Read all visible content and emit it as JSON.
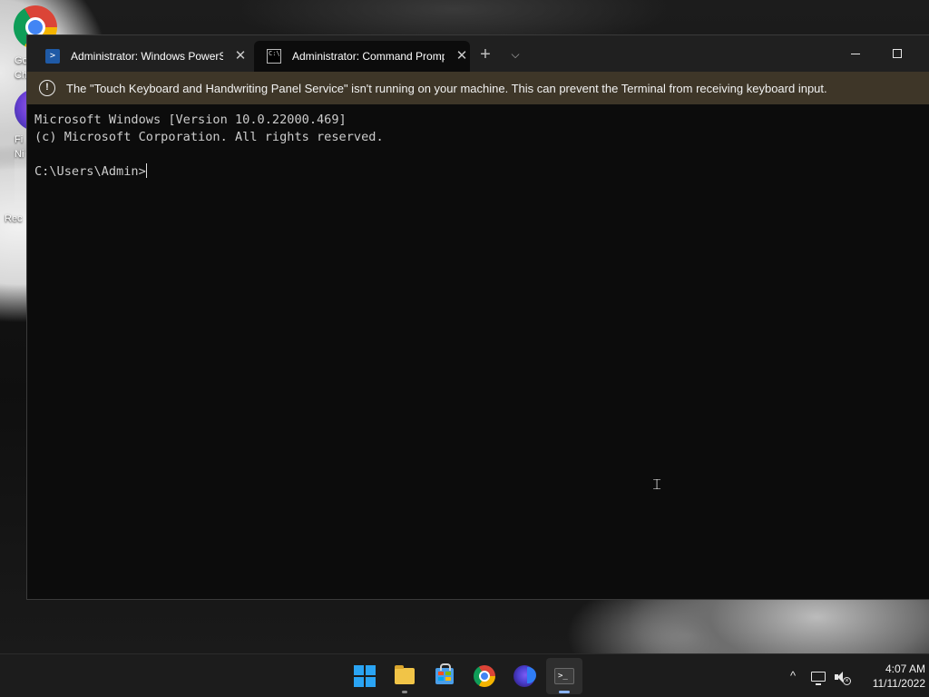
{
  "desktop": {
    "icons": [
      {
        "name": "google-chrome",
        "label_lines": [
          "Go",
          "Ch"
        ]
      },
      {
        "name": "firefox-nightly",
        "label_lines": [
          "Fi",
          "Ni"
        ]
      },
      {
        "name": "recycle-bin",
        "label_lines": [
          "Rec"
        ]
      }
    ]
  },
  "window": {
    "tabs": [
      {
        "title": "Administrator: Windows PowerS",
        "icon": "powershell-icon",
        "active": false
      },
      {
        "title": "Administrator: Command Promp",
        "icon": "cmd-icon",
        "active": true
      }
    ],
    "new_tab_glyph": "+",
    "dropdown_glyph": "⌵",
    "close_glyph": "✕"
  },
  "infobar": {
    "icon": "!",
    "message": "The \"Touch Keyboard and Handwriting Panel Service\" isn't running on your machine. This can prevent the Terminal from receiving keyboard input."
  },
  "console": {
    "lines": [
      "Microsoft Windows [Version 10.0.22000.469]",
      "(c) Microsoft Corporation. All rights reserved.",
      ""
    ],
    "prompt": "C:\\Users\\Admin>"
  },
  "taskbar": {
    "apps": [
      "start-button",
      "file-explorer",
      "microsoft-store",
      "google-chrome",
      "firefox-nightly",
      "windows-terminal"
    ],
    "active_app": "windows-terminal",
    "tray_overflow_glyph": "^",
    "clock": {
      "time": "4:07 AM",
      "date": "11/11/2022"
    }
  },
  "colors": {
    "terminal_bg": "#0c0c0c",
    "tabbar_bg": "#202020",
    "infobar_bg": "#3e3628",
    "taskbar_bg": "#1c1c1c",
    "accent": "#8ab4f8"
  }
}
